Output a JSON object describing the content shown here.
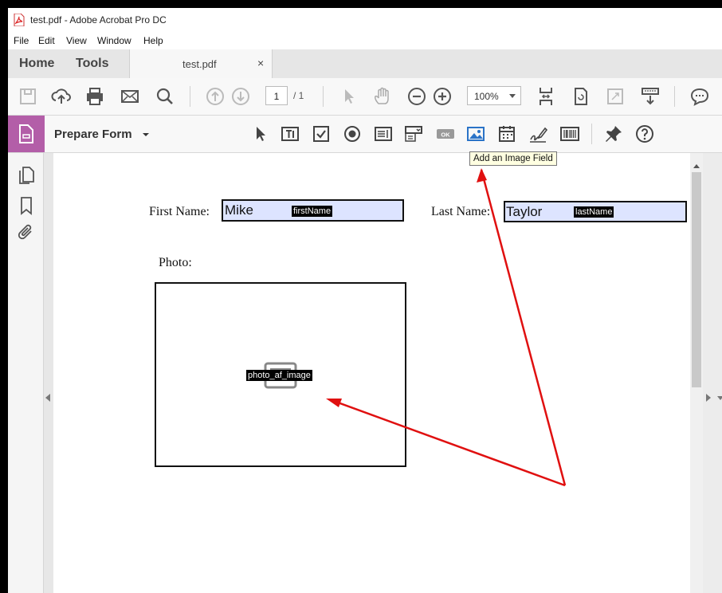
{
  "window": {
    "title": "test.pdf - Adobe Acrobat Pro DC"
  },
  "menu": [
    "File",
    "Edit",
    "View",
    "Window",
    "Help"
  ],
  "tabs": {
    "home": "Home",
    "tools": "Tools",
    "document": "test.pdf",
    "close": "×"
  },
  "toolbar": {
    "page_current": "1",
    "page_total": "/ 1",
    "zoom": "100%"
  },
  "formbar": {
    "label": "Prepare Form",
    "tooltip": "Add an Image Field"
  },
  "document": {
    "first_name_label": "First Name:",
    "first_name_value": "Mike",
    "first_name_tag": "firstName",
    "last_name_label": "Last Name:",
    "last_name_value": "Taylor",
    "last_name_tag": "lastName",
    "photo_label": "Photo:",
    "photo_tag": "photo_af_image"
  },
  "colors": {
    "accent": "#b35ea8",
    "field_fill": "#dde4ff",
    "annotation_arrow": "#e01010",
    "tooltip_bg": "#ffffe1"
  },
  "icons": [
    "save-icon",
    "upload-icon",
    "print-icon",
    "mail-icon",
    "search-icon",
    "prev-page-icon",
    "next-page-icon",
    "select-icon",
    "hand-icon",
    "zoom-out-icon",
    "zoom-in-icon",
    "fit-page-icon",
    "rotate-icon",
    "crop-icon",
    "scan-icon",
    "comment-icon",
    "form-icon",
    "cursor-icon",
    "text-field-icon",
    "checkbox-icon",
    "radio-icon",
    "list-box-icon",
    "dropdown-icon",
    "button-icon",
    "image-field-icon",
    "date-field-icon",
    "signature-icon",
    "barcode-icon",
    "pin-icon",
    "help-icon",
    "pages-icon",
    "bookmark-icon",
    "attachment-icon"
  ]
}
